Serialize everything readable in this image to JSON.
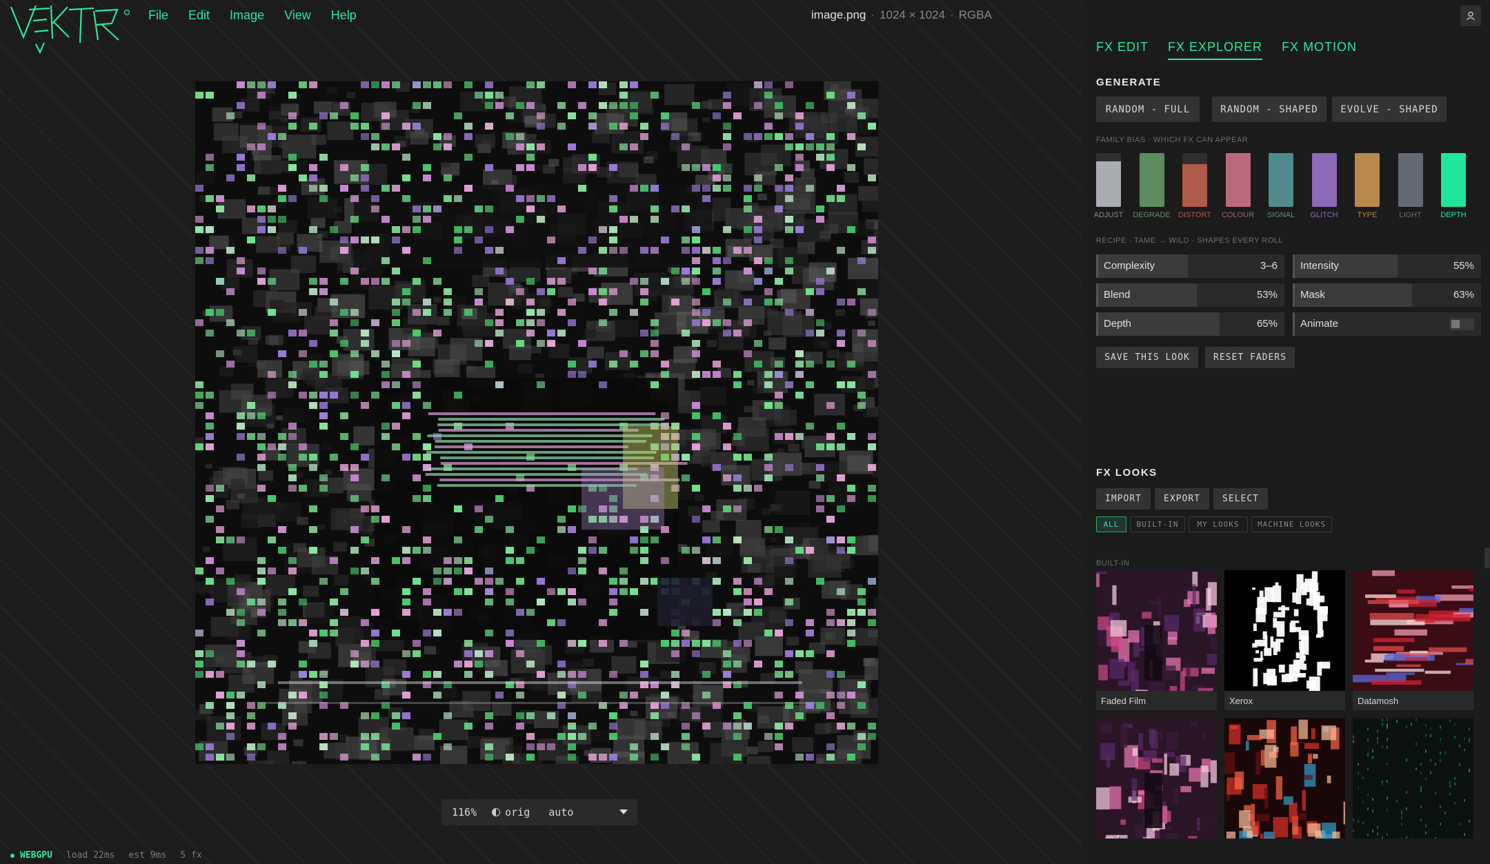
{
  "app": {
    "logo": "VEKTR"
  },
  "menu": {
    "items": [
      "File",
      "Edit",
      "Image",
      "View",
      "Help"
    ]
  },
  "file": {
    "name": "image.png",
    "dims": "1024 × 1024",
    "mode": "RGBA"
  },
  "viewer": {
    "zoom": "116%",
    "orig_label": "orig",
    "mode": "auto"
  },
  "status": {
    "gpu": "WEBGPU",
    "load": "load 22ms",
    "est": "est 9ms",
    "fx": "5 fx"
  },
  "panel": {
    "tabs": [
      {
        "label": "FX EDIT",
        "active": false
      },
      {
        "label": "FX EXPLORER",
        "active": true
      },
      {
        "label": "FX MOTION",
        "active": false
      }
    ],
    "generate": {
      "title": "GENERATE",
      "buttons": [
        "RANDOM - FULL",
        "RANDOM - SHAPED",
        "EVOLVE - SHAPED"
      ]
    },
    "family_bias": {
      "label": "FAMILY BIAS · WHICH FX CAN APPEAR",
      "families": [
        {
          "name": "ADJUST",
          "level": 0.85,
          "color": "#a9adb2",
          "label_color": "#8a8a8a"
        },
        {
          "name": "DEGRADE",
          "level": 1.0,
          "color": "#5f8c5f",
          "label_color": "#6f8a6f"
        },
        {
          "name": "DISTORT",
          "level": 0.8,
          "color": "#b05a4a",
          "label_color": "#b05a4a"
        },
        {
          "name": "COLOUR",
          "level": 1.0,
          "color": "#b86a7a",
          "label_color": "#9a6a74"
        },
        {
          "name": "SIGNAL",
          "level": 1.0,
          "color": "#4f8a8c",
          "label_color": "#5f8a8c"
        },
        {
          "name": "GLITCH",
          "level": 1.0,
          "color": "#8e6ab8",
          "label_color": "#8e6ab8"
        },
        {
          "name": "TYPE",
          "level": 1.0,
          "color": "#b8894a",
          "label_color": "#b8894a"
        },
        {
          "name": "LIGHT",
          "level": 1.0,
          "color": "#636a74",
          "label_color": "#6a6f76"
        },
        {
          "name": "DEPTH",
          "level": 1.0,
          "color": "#1fe59a",
          "label_color": "#2ee89a"
        }
      ]
    },
    "recipe": {
      "label": "RECIPE · TAME → WILD · SHAPES EVERY ROLL",
      "faders": [
        {
          "name": "Complexity",
          "value": "3–6",
          "level": 0.48
        },
        {
          "name": "Intensity",
          "value": "55%",
          "level": 0.55
        },
        {
          "name": "Blend",
          "value": "53%",
          "level": 0.53
        },
        {
          "name": "Mask",
          "value": "63%",
          "level": 0.63
        },
        {
          "name": "Depth",
          "value": "65%",
          "level": 0.65
        },
        {
          "name": "Animate",
          "value": "",
          "level": 0,
          "toggle": true
        }
      ],
      "buttons": [
        "SAVE THIS LOOK",
        "RESET FADERS"
      ]
    },
    "looks": {
      "title": "FX LOOKS",
      "actions": [
        "IMPORT",
        "EXPORT",
        "SELECT"
      ],
      "filters": [
        {
          "label": "ALL",
          "active": true
        },
        {
          "label": "BUILT-IN",
          "active": false
        },
        {
          "label": "MY LOOKS",
          "active": false
        },
        {
          "label": "MACHINE LOOKS",
          "active": false
        }
      ],
      "section": "BUILT-IN",
      "items": [
        {
          "name": "Faded Film",
          "style": "film"
        },
        {
          "name": "Xerox",
          "style": "xerox"
        },
        {
          "name": "Datamosh",
          "style": "mosh"
        },
        {
          "name": "",
          "style": "halftone"
        },
        {
          "name": "",
          "style": "red"
        },
        {
          "name": "",
          "style": "matrix"
        }
      ]
    }
  },
  "colors": {
    "accent": "#2ee89a",
    "panel_bg": "#1b1b1b",
    "button_bg": "#333333"
  }
}
